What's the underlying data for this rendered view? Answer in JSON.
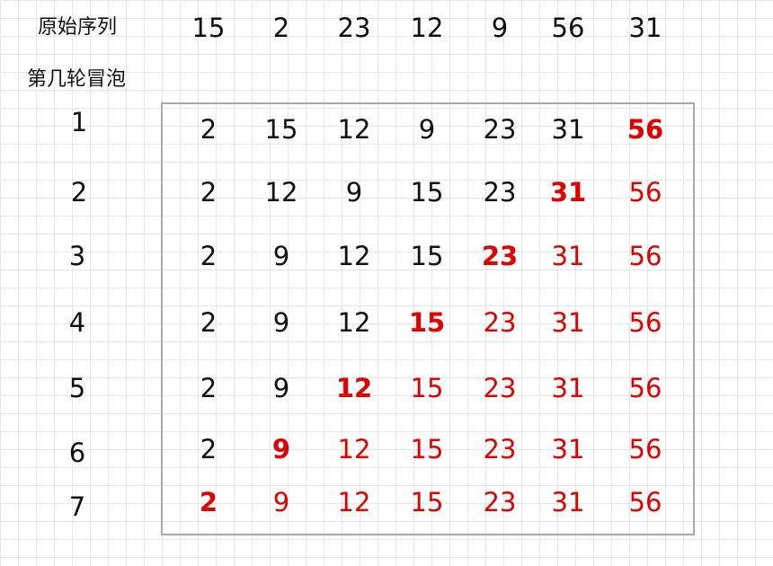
{
  "header": {
    "original_label": "原始序列",
    "round_label": "第几轮冒泡"
  },
  "original_sequence": [
    15,
    2,
    23,
    12,
    9,
    56,
    31
  ],
  "rounds": [
    {
      "label": "1",
      "values": [
        2,
        15,
        12,
        9,
        23,
        31,
        56
      ],
      "sorted_from": 6
    },
    {
      "label": "2",
      "values": [
        2,
        12,
        9,
        15,
        23,
        31,
        56
      ],
      "sorted_from": 5
    },
    {
      "label": "3",
      "values": [
        2,
        9,
        12,
        15,
        23,
        31,
        56
      ],
      "sorted_from": 4
    },
    {
      "label": "4",
      "values": [
        2,
        9,
        12,
        15,
        23,
        31,
        56
      ],
      "sorted_from": 3
    },
    {
      "label": "5",
      "values": [
        2,
        9,
        12,
        15,
        23,
        31,
        56
      ],
      "sorted_from": 2
    },
    {
      "label": "6",
      "values": [
        2,
        9,
        12,
        15,
        23,
        31,
        56
      ],
      "sorted_from": 1
    },
    {
      "label": "7",
      "values": [
        2,
        9,
        12,
        15,
        23,
        31,
        56
      ],
      "sorted_from": 0
    }
  ],
  "colors": {
    "sorted": "#e00000",
    "default": "#111111",
    "grid": "#e6e6e6",
    "box_border": "#a8a8a8"
  }
}
